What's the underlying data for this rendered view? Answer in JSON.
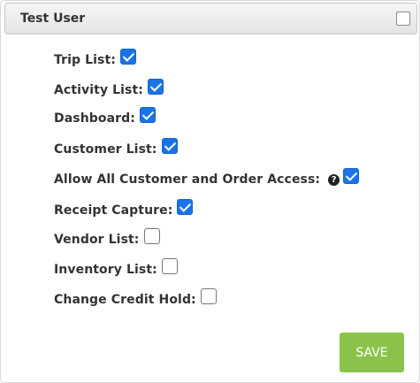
{
  "panel": {
    "title": "Test User",
    "select_all_checked": false
  },
  "permissions": [
    {
      "label": "Trip List:",
      "checked": true
    },
    {
      "label": "Activity List:",
      "checked": true
    },
    {
      "label": "Dashboard:",
      "checked": true
    },
    {
      "label": "Customer List:",
      "checked": true
    },
    {
      "label": "Allow All Customer and Order Access:",
      "checked": true,
      "help_icon": "question-circle-icon"
    },
    {
      "label": "Receipt Capture:",
      "checked": true
    },
    {
      "label": "Vendor List:",
      "checked": false
    },
    {
      "label": "Inventory List:",
      "checked": false
    },
    {
      "label": "Change Credit Hold:",
      "checked": false
    }
  ],
  "actions": {
    "save_label": "SAVE"
  },
  "colors": {
    "checkbox_checked": "#1a73e8",
    "save_button": "#8bc34a"
  }
}
